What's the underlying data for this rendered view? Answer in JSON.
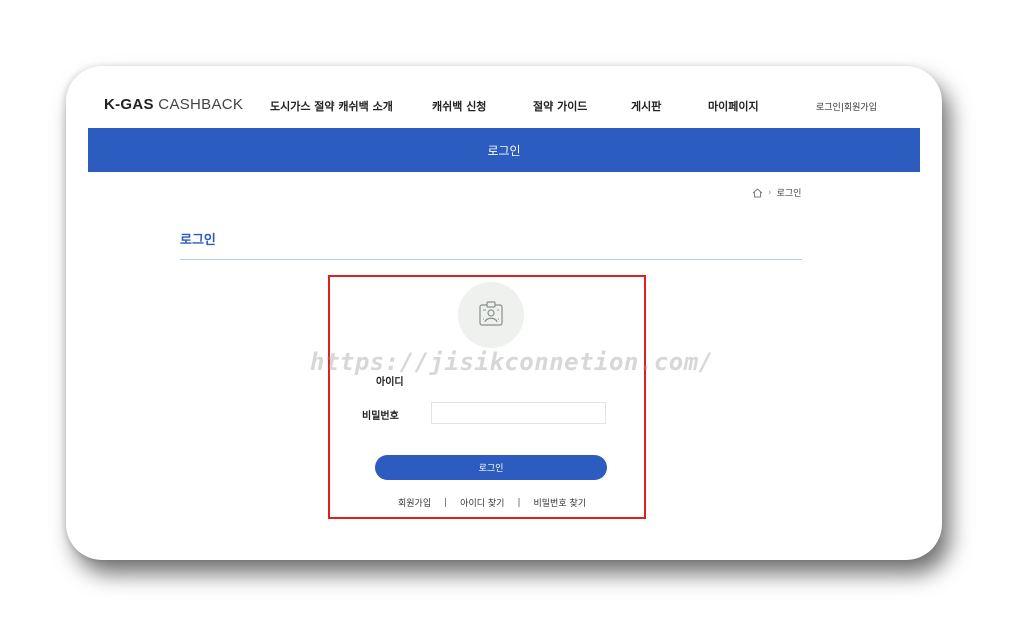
{
  "header": {
    "logo_bold": "K-GAS",
    "logo_light": " CASHBACK",
    "nav": [
      {
        "label": "도시가스 절약 캐쉬백 소개"
      },
      {
        "label": "캐쉬백 신청"
      },
      {
        "label": "절약 가이드"
      },
      {
        "label": "게시판"
      },
      {
        "label": "마이페이지"
      }
    ],
    "util_links": "로그인|회원가입"
  },
  "banner": {
    "title": "로그인"
  },
  "breadcrumb": {
    "current": "로그인"
  },
  "page": {
    "title": "로그인"
  },
  "form": {
    "id_label": "아이디",
    "pw_label": "비밀번호",
    "pw_value": "",
    "submit_label": "로그인"
  },
  "links": {
    "signup": "회원가입",
    "find_id": "아이디 찾기",
    "find_pw": "비밀번호 찾기",
    "separator": "|"
  },
  "watermark": "https://jisikconnetion.com/",
  "colors": {
    "primary": "#2c5cbf",
    "highlight": "#e02020",
    "rule": "#b9cbe6"
  },
  "icons": {
    "home": "home-icon",
    "chevron": "chevron-right-icon",
    "login": "login-badge-icon"
  }
}
